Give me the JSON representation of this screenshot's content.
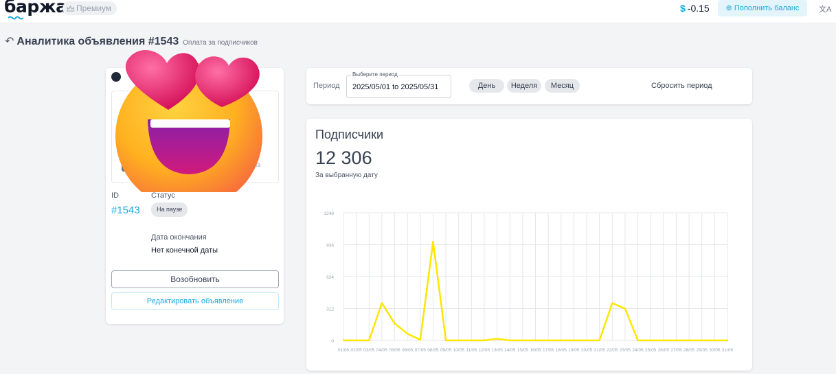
{
  "header": {
    "logo": "баржа",
    "premium_label": "Премиум",
    "currency_symbol": "$",
    "balance": "-0.15",
    "topup_label": "Пополнить баланс",
    "translate_icon": "translate-icon"
  },
  "page": {
    "title": "Аналитика объявления #1543",
    "subtitle": "Оплата за подписчиков"
  },
  "ad_card": {
    "preview_line1": "р",
    "preview_line2": "у",
    "preview_button": "По",
    "preview_text": "ама",
    "id_label": "ID",
    "id_value": "#1543",
    "status_label": "Статус",
    "status_value": "На паузе",
    "end_label": "Дата окончания",
    "end_value": "Нет конечной даты",
    "resume_label": "Возобновить",
    "edit_label": "Редактировать объявление"
  },
  "period": {
    "label": "Период",
    "field_legend": "Выберите период",
    "field_value": "2025/05/01 to 2025/05/31",
    "chips": [
      "День",
      "Неделя",
      "Месяц"
    ],
    "reset_label": "Сбросить период"
  },
  "stats": {
    "title": "Подписчики",
    "value": "12 306",
    "caption": "За выбранную дату"
  },
  "chart_data": {
    "type": "line",
    "color": "#ffe600",
    "x": [
      "01/05",
      "02/05",
      "03/05",
      "04/05",
      "05/05",
      "06/05",
      "07/05",
      "08/05",
      "09/05",
      "10/05",
      "11/05",
      "12/05",
      "13/05",
      "14/05",
      "15/05",
      "16/05",
      "17/05",
      "18/05",
      "19/05",
      "20/05",
      "21/05",
      "22/05",
      "23/05",
      "24/05",
      "25/05",
      "26/05",
      "27/05",
      "28/05",
      "29/05",
      "30/05",
      "31/05"
    ],
    "values": [
      0,
      0,
      0,
      365,
      165,
      65,
      5,
      965,
      0,
      0,
      0,
      0,
      15,
      0,
      0,
      0,
      0,
      0,
      0,
      0,
      0,
      365,
      310,
      0,
      0,
      0,
      0,
      0,
      0,
      0,
      0
    ],
    "yticks": [
      0,
      312,
      624,
      936,
      1248
    ],
    "ylim": [
      0,
      1248
    ],
    "grid": true
  }
}
